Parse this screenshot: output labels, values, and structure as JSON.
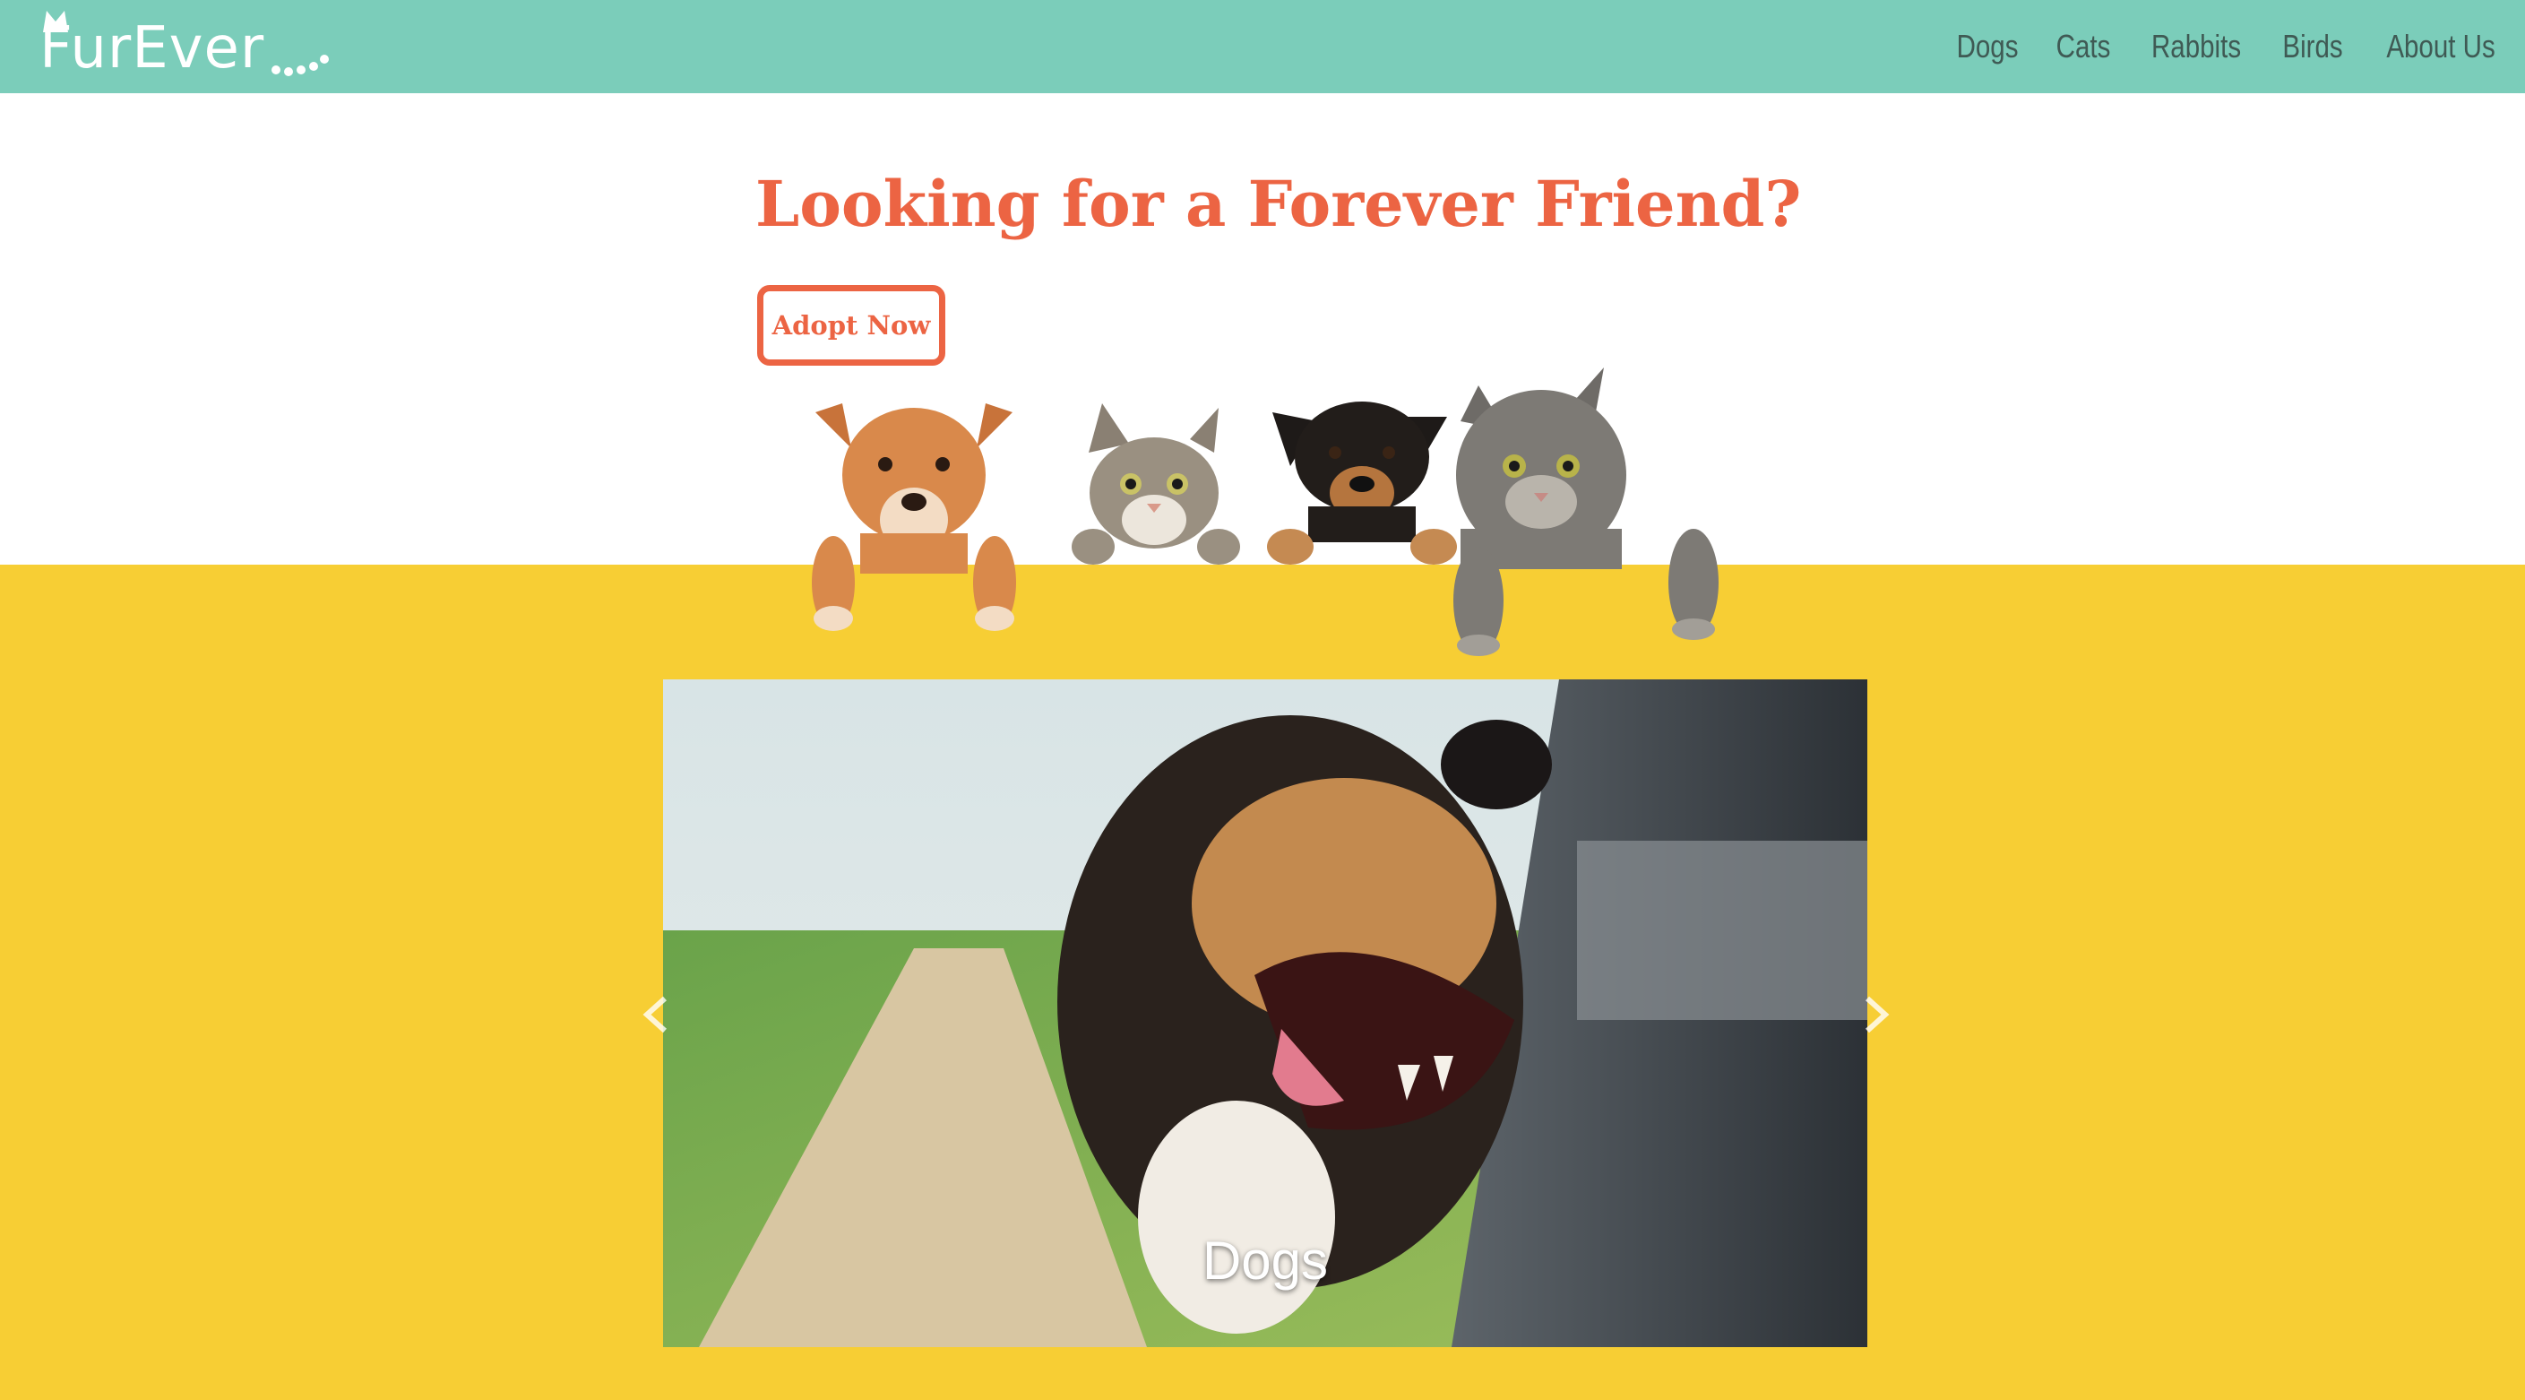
{
  "brand": {
    "logo_text": "FurEver",
    "color": "#7bcdba"
  },
  "nav": {
    "items": [
      {
        "label": "Dogs"
      },
      {
        "label": "Cats"
      },
      {
        "label": "Rabbits"
      },
      {
        "label": "Birds"
      },
      {
        "label": "About Us"
      }
    ]
  },
  "hero": {
    "title": "Looking for a Forever Friend?",
    "button_label": "Adopt Now",
    "accent_color": "#ec6443"
  },
  "band": {
    "color": "#f7ce34"
  },
  "carousel": {
    "slide_caption": "Dogs",
    "prev_icon": "chevron-left-icon",
    "next_icon": "chevron-right-icon"
  }
}
